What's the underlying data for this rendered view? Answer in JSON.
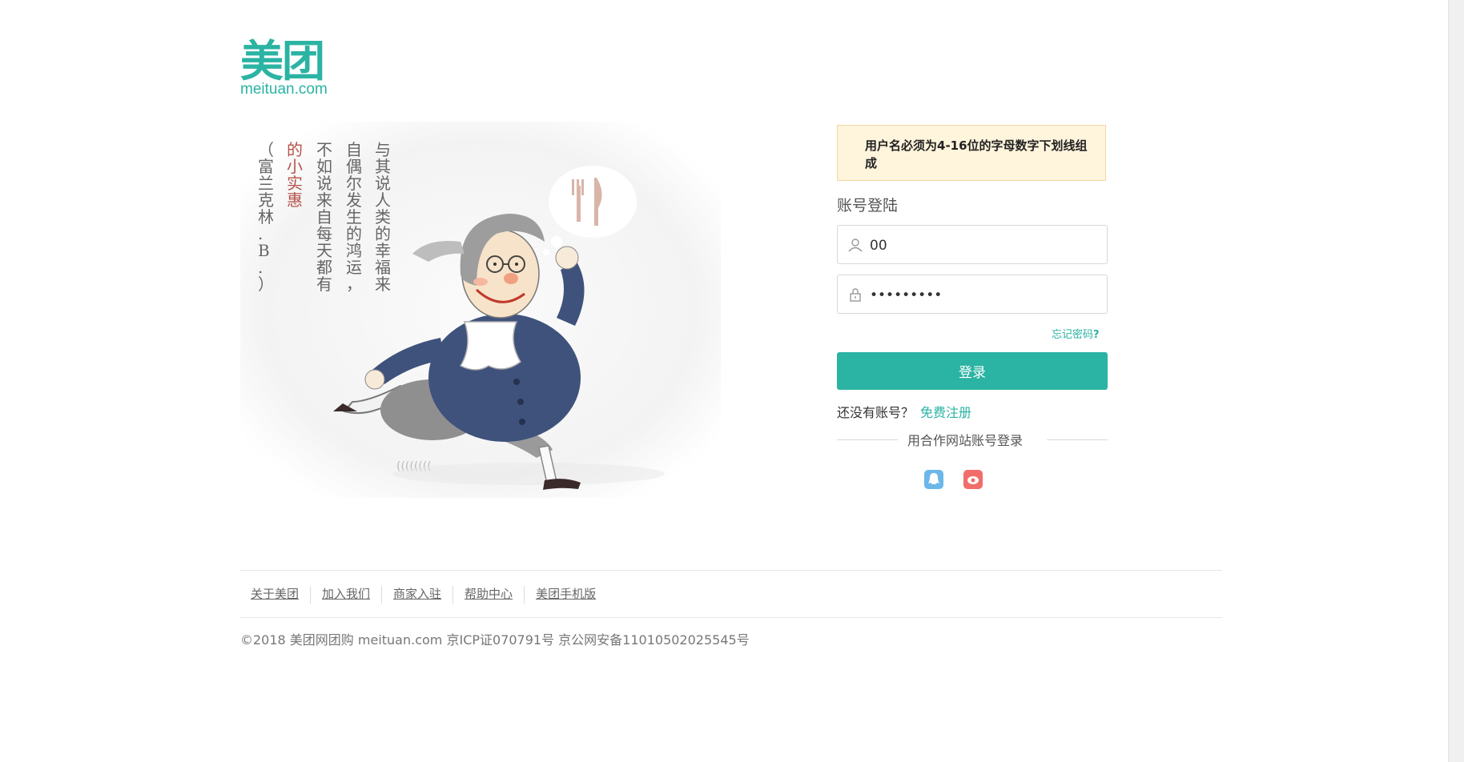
{
  "logo": {
    "cn": "美团",
    "en": "meituan.com"
  },
  "illustration": {
    "quote_cols": [
      "与其说人类的幸福来",
      "自偶尔发生的鸿运，",
      "不如说来自每天都有",
      "的小实惠"
    ],
    "author": "（富兰克林.B.）"
  },
  "notice": "用户名必须为4-16位的字母数字下划线组成",
  "login": {
    "title": "账号登陆",
    "username_value": "00",
    "password_value": "•••••••••",
    "forgot_label": "忘记密码",
    "forgot_mark": "?",
    "submit_label": "登录",
    "no_account": "还没有账号？",
    "register_label": "免费注册",
    "partner_label": "用合作网站账号登录"
  },
  "footer": {
    "links": [
      "关于美团",
      "加入我们",
      "商家入驻",
      "帮助中心",
      "美团手机版"
    ],
    "copyright": "©2018 美团网团购 meituan.com 京ICP证070791号 京公网安备11010502025545号"
  },
  "colors": {
    "brand": "#2bb3a3",
    "notice_bg": "#fff4dc",
    "qq": "#6cb7ea",
    "weibo": "#f06d6a"
  }
}
